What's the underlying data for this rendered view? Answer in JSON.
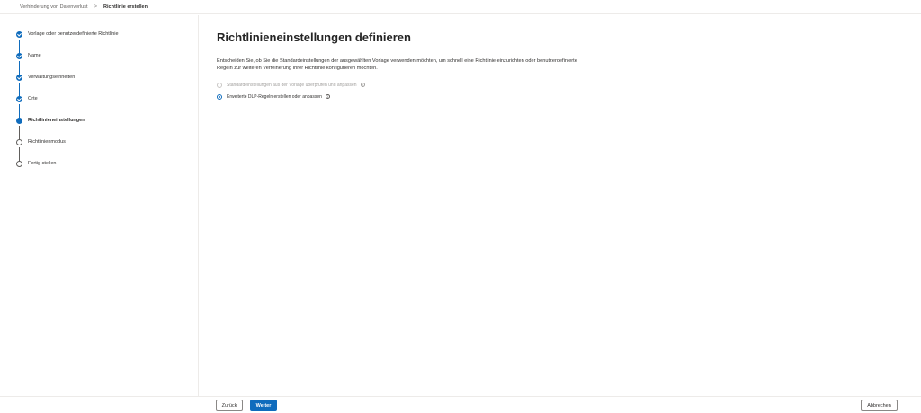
{
  "breadcrumb": {
    "parent": "Verhinderung von Datenverlust",
    "separator": ">",
    "current": "Richtlinie erstellen"
  },
  "steps": [
    {
      "label": "Vorlage oder benutzerdefinierte Richtlinie",
      "status": "done"
    },
    {
      "label": "Name",
      "status": "done"
    },
    {
      "label": "Verwaltungseinheiten",
      "status": "done"
    },
    {
      "label": "Orte",
      "status": "done"
    },
    {
      "label": "Richtlinieneinstellungen",
      "status": "current"
    },
    {
      "label": "Richtlinienmodus",
      "status": "pending"
    },
    {
      "label": "Fertig stellen",
      "status": "pending"
    }
  ],
  "main": {
    "title": "Richtlinieneinstellungen definieren",
    "description": "Entscheiden Sie, ob Sie die Standardeinstellungen der ausgewählten Vorlage verwenden möchten, um schnell eine Richtlinie einzurichten oder benutzerdefinierte Regeln zur weiteren Verfeinerung Ihrer Richtlinie konfigurieren möchten.",
    "options": [
      {
        "label": "Standardeinstellungen aus der Vorlage überprüfen und anpassen",
        "selected": false,
        "disabled": true
      },
      {
        "label": "Erweiterte DLP-Regeln erstellen oder anpassen",
        "selected": true,
        "disabled": false
      }
    ],
    "info_glyph": "i"
  },
  "footer": {
    "back_label": "Zurück",
    "next_label": "Weiter",
    "cancel_label": "Abbrechen"
  },
  "colors": {
    "accent": "#0f6cbd",
    "border": "#edebe9"
  },
  "icons": {
    "check": "checkmark-icon",
    "info": "info-icon"
  }
}
